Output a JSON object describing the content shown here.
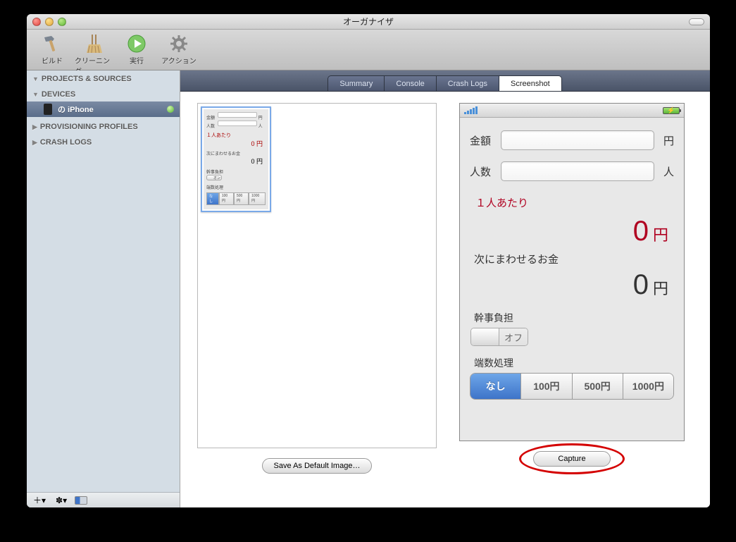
{
  "window": {
    "title": "オーガナイザ"
  },
  "toolbar": [
    {
      "id": "build",
      "label": "ビルド"
    },
    {
      "id": "clean",
      "label": "クリーニング"
    },
    {
      "id": "run",
      "label": "実行"
    },
    {
      "id": "action",
      "label": "アクション"
    }
  ],
  "sidebar": {
    "groups": [
      {
        "title": "PROJECTS & SOURCES",
        "open": true
      },
      {
        "title": "DEVICES",
        "open": true
      },
      {
        "title": "PROVISIONING PROFILES",
        "open": false
      },
      {
        "title": "CRASH LOGS",
        "open": false
      }
    ],
    "device_name": "の iPhone"
  },
  "tabs": [
    "Summary",
    "Console",
    "Crash Logs",
    "Screenshot"
  ],
  "active_tab": "Screenshot",
  "buttons": {
    "save_default": "Save As Default Image…",
    "capture": "Capture"
  },
  "app": {
    "fields": {
      "amount_label": "金額",
      "amount_unit": "円",
      "people_label": "人数",
      "people_unit": "人"
    },
    "per_person_label": "１人あたり",
    "per_person_value": "0",
    "per_person_unit": "円",
    "carry_label": "次にまわせるお金",
    "carry_value": "0",
    "carry_unit": "円",
    "organizer_label": "幹事負担",
    "switch_off": "オフ",
    "rounding_label": "端数処理",
    "rounding_options": [
      "なし",
      "100円",
      "500円",
      "1000円"
    ],
    "rounding_selected": "なし"
  },
  "thumb": {
    "labels": {
      "amount": "金額",
      "people": "人数",
      "per": "１人あたり",
      "carry": "次にまわせるお金",
      "org": "幹事負担",
      "round": "端数処理"
    },
    "zero_text": "0 円",
    "segs": [
      "なし",
      "100円",
      "500円",
      "1000円"
    ]
  }
}
